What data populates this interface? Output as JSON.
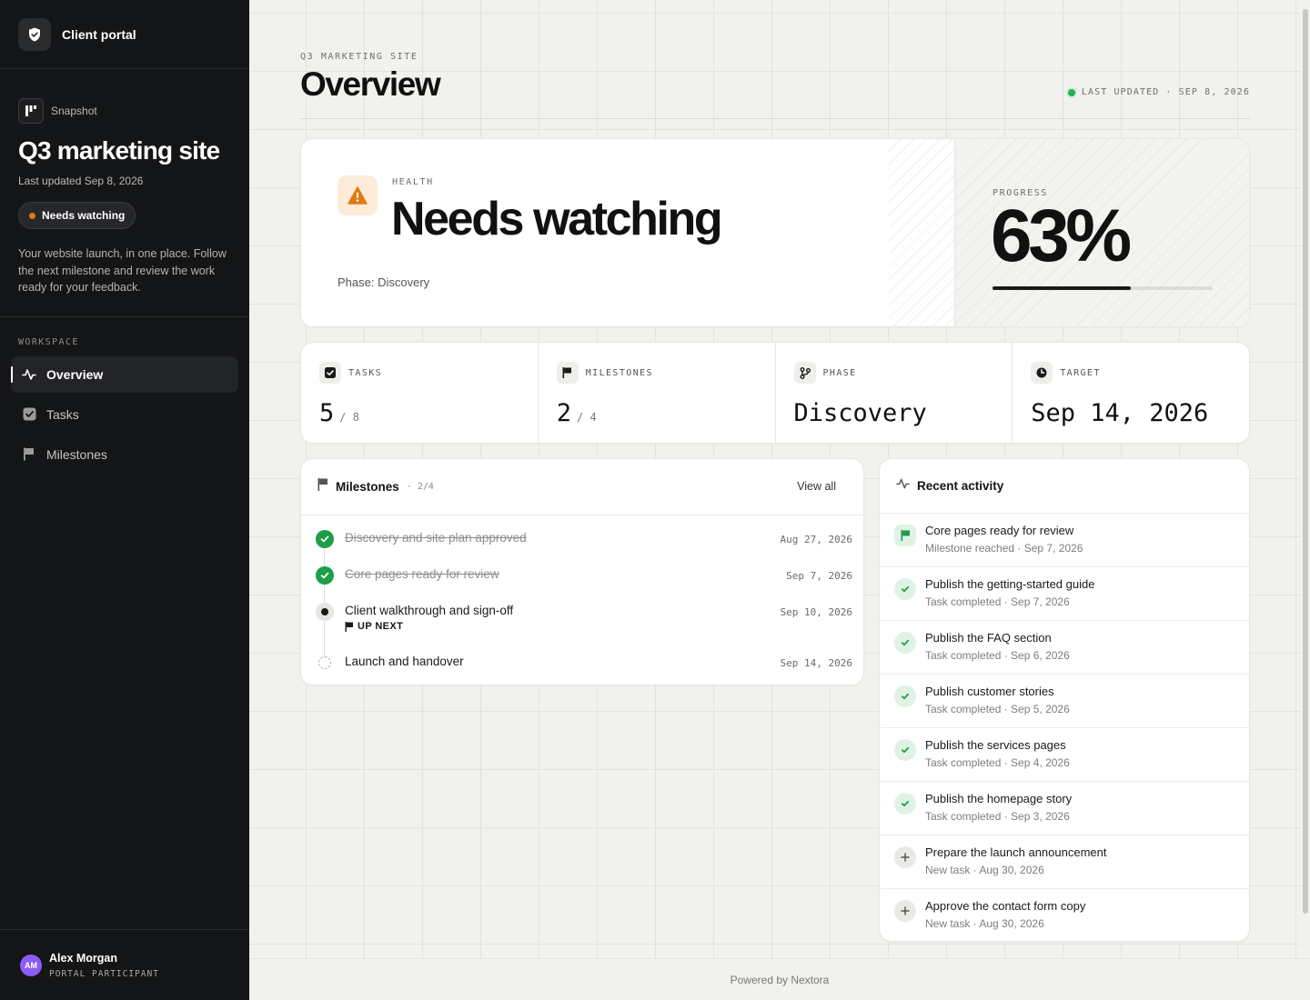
{
  "brand": {
    "name": "Client portal"
  },
  "snapshot": {
    "label": "Snapshot",
    "title": "Q3 marketing site",
    "last_updated": "Last updated Sep 8, 2026",
    "status": "Needs watching",
    "status_color": "#e07b12",
    "description": "Your website launch, in one place. Follow the next milestone and review the work ready for your feedback."
  },
  "nav": {
    "section_label": "WORKSPACE",
    "items": [
      {
        "label": "Overview",
        "icon": "activity-icon",
        "active": true
      },
      {
        "label": "Tasks",
        "icon": "checkbox-icon",
        "active": false
      },
      {
        "label": "Milestones",
        "icon": "flag-icon",
        "active": false
      }
    ]
  },
  "user": {
    "initials": "AM",
    "name": "Alex Morgan",
    "role": "PORTAL PARTICIPANT",
    "avatar_color": "#8b5cf6"
  },
  "header": {
    "kicker": "Q3 MARKETING SITE",
    "title": "Overview",
    "last_updated": "LAST UPDATED · SEP 8, 2026"
  },
  "hero": {
    "health_label": "HEALTH",
    "health_value": "Needs watching",
    "phase": "Phase: Discovery",
    "progress_label": "PROGRESS",
    "progress_value": "63%",
    "progress_fraction": 0.63
  },
  "stats": [
    {
      "label": "TASKS",
      "value": "5",
      "sub": "/ 8",
      "icon": "checkbox-icon"
    },
    {
      "label": "MILESTONES",
      "value": "2",
      "sub": "/ 4",
      "icon": "flag-icon"
    },
    {
      "label": "PHASE",
      "value": "Discovery",
      "sub": "",
      "icon": "branch-icon"
    },
    {
      "label": "TARGET",
      "value": "Sep 14, 2026",
      "sub": "",
      "icon": "clock-icon"
    }
  ],
  "milestones": {
    "title": "Milestones",
    "count": "· 2/4",
    "view_all": "View all",
    "up_next_label": "UP NEXT",
    "items": [
      {
        "name": "Discovery and site plan approved",
        "date": "Aug 27, 2026",
        "status": "done"
      },
      {
        "name": "Core pages ready for review",
        "date": "Sep 7, 2026",
        "status": "done"
      },
      {
        "name": "Client walkthrough and sign-off",
        "date": "Sep 10, 2026",
        "status": "current"
      },
      {
        "name": "Launch and handover",
        "date": "Sep 14, 2026",
        "status": "todo"
      }
    ]
  },
  "activity": {
    "title": "Recent activity",
    "items": [
      {
        "name": "Core pages ready for review",
        "meta": "Milestone reached · Sep 7, 2026",
        "icon": "flag"
      },
      {
        "name": "Publish the getting-started guide",
        "meta": "Task completed · Sep 7, 2026",
        "icon": "check"
      },
      {
        "name": "Publish the FAQ section",
        "meta": "Task completed · Sep 6, 2026",
        "icon": "check"
      },
      {
        "name": "Publish customer stories",
        "meta": "Task completed · Sep 5, 2026",
        "icon": "check"
      },
      {
        "name": "Publish the services pages",
        "meta": "Task completed · Sep 4, 2026",
        "icon": "check"
      },
      {
        "name": "Publish the homepage story",
        "meta": "Task completed · Sep 3, 2026",
        "icon": "check"
      },
      {
        "name": "Prepare the launch announcement",
        "meta": "New task · Aug 30, 2026",
        "icon": "plus"
      },
      {
        "name": "Approve the contact form copy",
        "meta": "New task · Aug 30, 2026",
        "icon": "plus"
      }
    ]
  },
  "footer": {
    "text": "Powered by Nextora"
  },
  "colors": {
    "success": "#1e9e46",
    "warning": "#e07b12",
    "sidebar": "#141516"
  }
}
